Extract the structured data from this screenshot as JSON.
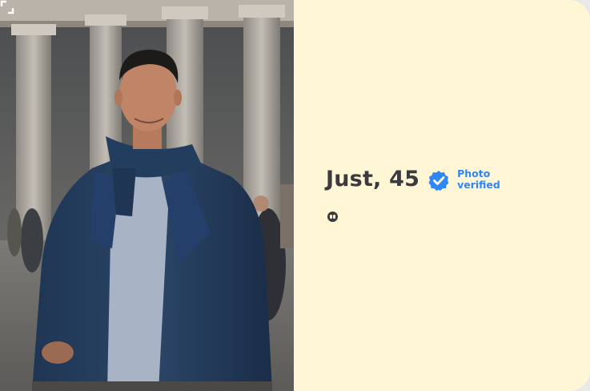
{
  "profile": {
    "name_age": "Just, 45",
    "verified_line1": "Photo",
    "verified_line2": "verified"
  },
  "icons": {
    "expand": "expand-icon",
    "verified": "verified-check-icon",
    "quote": "quote-icon"
  },
  "colors": {
    "card_background": "#fff6d6",
    "name_text": "#3b3a3f",
    "verified_blue": "#2f86f5"
  }
}
